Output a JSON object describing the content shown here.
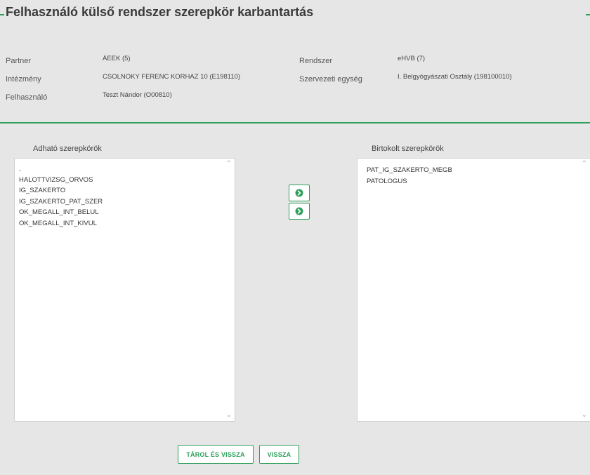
{
  "page": {
    "title": "Felhasználó külső rendszer szerepkör karbantartás"
  },
  "info": {
    "partner_label": "Partner",
    "partner_value": "ÁEEK (5)",
    "intezmeny_label": "Intézmény",
    "intezmeny_value": "CSOLNOKY FERENC KORHAZ 10 (E198110)",
    "felhasznalo_label": "Felhasználó",
    "felhasznalo_value": "Teszt Nándor (O00810)",
    "rendszer_label": "Rendszer",
    "rendszer_value": "eHVB (7)",
    "szervezeti_label": "Szervezeti egység",
    "szervezeti_value": "I. Belgyógyászati Osztály (198100010)"
  },
  "available": {
    "heading": "Adható szerepkörök",
    "items": [
      ",",
      "HALOTTVIZSG_ORVOS",
      "IG_SZAKERTO",
      "IG_SZAKERTO_PAT_SZER",
      "OK_MEGALL_INT_BELUL",
      "OK_MEGALL_INT_KIVUL"
    ]
  },
  "assigned": {
    "heading": "Birtokolt szerepkörök",
    "items": [
      "PAT_IG_SZAKERTO_MEGB",
      "PATOLOGUS"
    ]
  },
  "icons": {
    "add": "circle-arrow-right-icon",
    "remove": "circle-arrow-right-icon",
    "scroll_up": "chevron-up-icon",
    "scroll_down": "chevron-down-icon"
  },
  "buttons": {
    "save": "TÁROL ÉS VISSZA",
    "back": "VISSZA"
  },
  "colors": {
    "accent": "#2e9e5b",
    "background": "#e6e6e6",
    "panel": "#ffffff"
  }
}
